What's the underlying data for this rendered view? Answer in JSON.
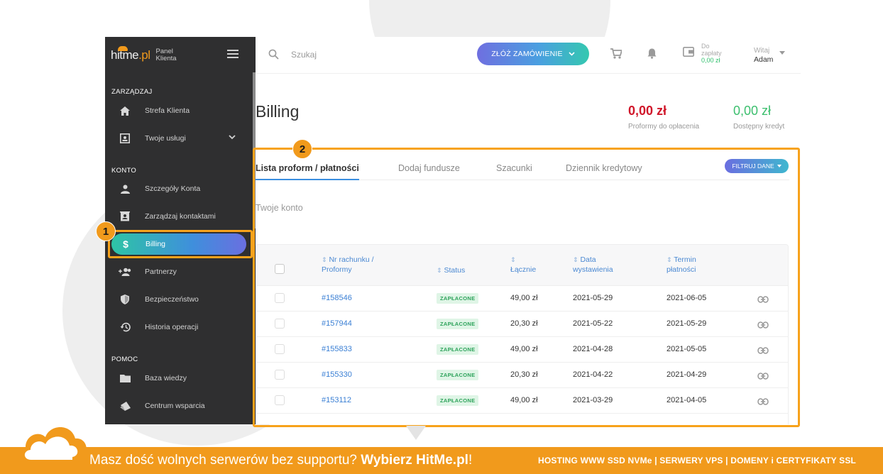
{
  "sidebar": {
    "logo_text": "hitme",
    "logo_tld": ".pl",
    "panel_label": "Panel Klienta",
    "sections": {
      "manage": "ZARZĄDZAJ",
      "account": "KONTO",
      "help": "POMOC"
    },
    "items": [
      {
        "label": "Strefa Klienta",
        "icon": "home-icon"
      },
      {
        "label": "Twoje usługi",
        "icon": "services-icon"
      },
      {
        "label": "Szczegóły Konta",
        "icon": "user-icon"
      },
      {
        "label": "Zarządzaj kontaktami",
        "icon": "contacts-icon"
      },
      {
        "label": "Billing",
        "icon": "dollar-icon"
      },
      {
        "label": "Partnerzy",
        "icon": "partners-icon"
      },
      {
        "label": "Bezpieczeństwo",
        "icon": "shield-icon"
      },
      {
        "label": "Historia operacji",
        "icon": "history-icon"
      },
      {
        "label": "Baza wiedzy",
        "icon": "folder-icon"
      },
      {
        "label": "Centrum wsparcia",
        "icon": "tickets-icon"
      }
    ]
  },
  "topbar": {
    "search_placeholder": "Szukaj",
    "order_button": "ZŁÓŻ ZAMÓWIENIE",
    "due_label_1": "Do",
    "due_label_2": "zapłaty",
    "due_amount": "0,00 zł",
    "greeting": "Witaj",
    "user_name": "Adam"
  },
  "page": {
    "title": "Billing",
    "proforms_due_value": "0,00 zł",
    "proforms_due_label": "Proformy do opłacenia",
    "credit_value": "0,00 zł",
    "credit_label": "Dostępny kredyt"
  },
  "tabs": [
    {
      "label": "Lista proform / płatności",
      "active": true
    },
    {
      "label": "Dodaj fundusze"
    },
    {
      "label": "Szacunki"
    },
    {
      "label": "Dziennik kredytowy"
    }
  ],
  "filter_button": "FILTRUJ DANE",
  "subtitle": "Twoje konto",
  "table": {
    "headers": {
      "number_1": "Nr rachunku /",
      "number_2": "Proformy",
      "status": "Status",
      "total": "Łącznie",
      "issued_1": "Data",
      "issued_2": "wystawienia",
      "due_1": "Termin",
      "due_2": "płatności"
    },
    "rows": [
      {
        "number": "#158546",
        "status": "ZAPŁACONE",
        "total": "49,00 zł",
        "issued": "2021-05-29",
        "due": "2021-06-05"
      },
      {
        "number": "#157944",
        "status": "ZAPŁACONE",
        "total": "20,30 zł",
        "issued": "2021-05-22",
        "due": "2021-05-29"
      },
      {
        "number": "#155833",
        "status": "ZAPŁACONE",
        "total": "49,00 zł",
        "issued": "2021-04-28",
        "due": "2021-05-05"
      },
      {
        "number": "#155330",
        "status": "ZAPŁACONE",
        "total": "20,30 zł",
        "issued": "2021-04-22",
        "due": "2021-04-29"
      },
      {
        "number": "#153112",
        "status": "ZAPŁACONE",
        "total": "49,00 zł",
        "issued": "2021-03-29",
        "due": "2021-04-05"
      }
    ]
  },
  "annotations": {
    "one": "1",
    "two": "2"
  },
  "banner": {
    "left_text": "Masz dość wolnych serwerów bez supportu? ",
    "left_bold": "Wybierz HitMe.pl",
    "left_end": "!",
    "right_text": "HOSTING WWW SSD NVMe | SERWERY VPS | DOMENY i CERTYFIKATY SSL"
  },
  "colors": {
    "accent_orange": "#f19a1c",
    "sidebar_bg": "#2f2f30",
    "due_red": "#d0172a",
    "credit_green": "#3cbf6e",
    "link_blue": "#3a7fd4"
  }
}
